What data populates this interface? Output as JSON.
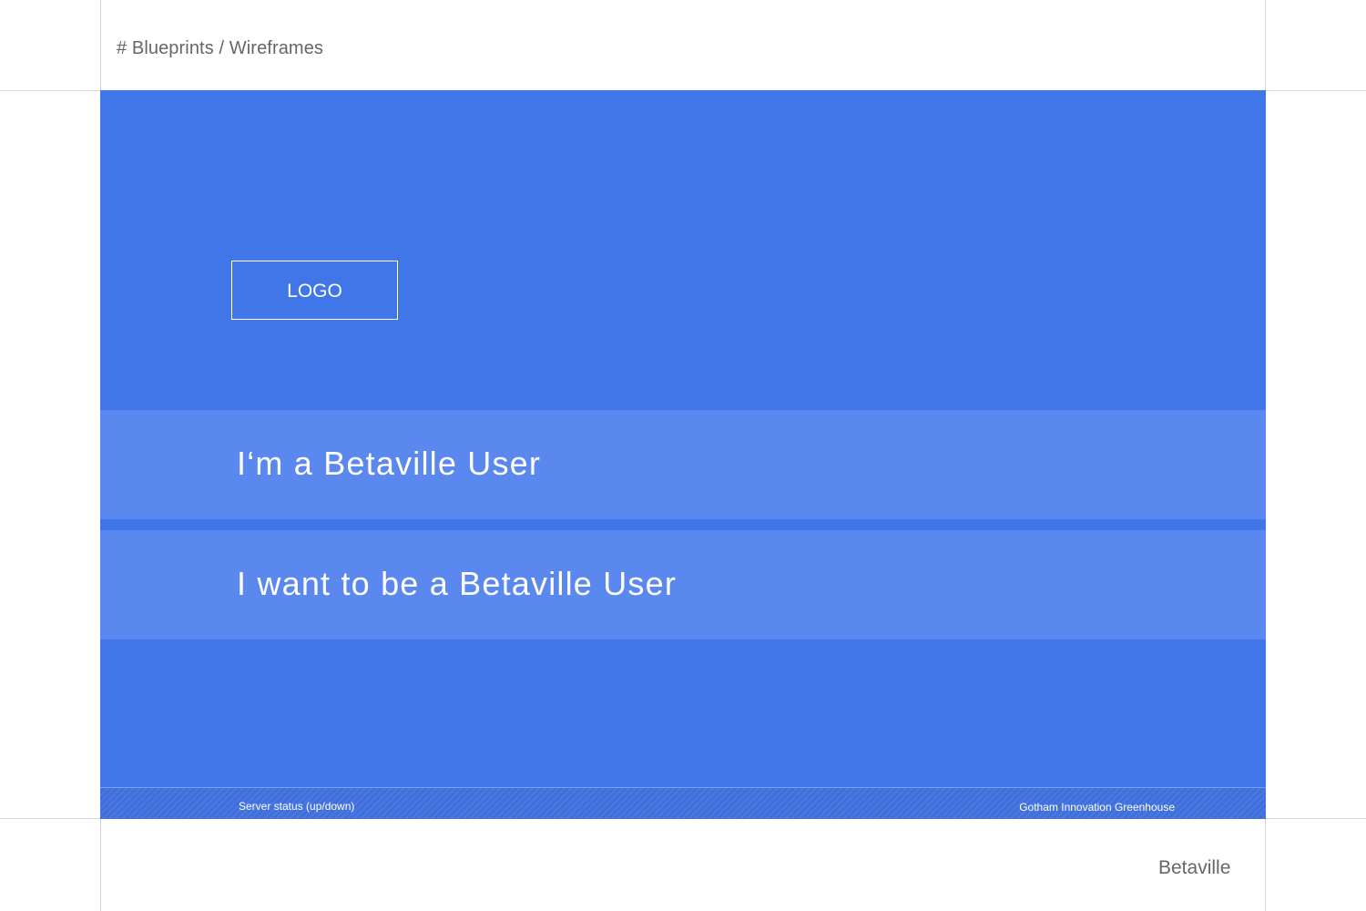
{
  "header": {
    "breadcrumb": "# Blueprints / Wireframes"
  },
  "screen": {
    "logo_placeholder": "LOGO",
    "options": [
      {
        "label": "I‘m a Betaville User"
      },
      {
        "label": "I want to be a Betaville User"
      }
    ],
    "footer": {
      "server_status": "Server status (up/down)",
      "organization": "Gotham Innovation Greenhouse"
    }
  },
  "brand": {
    "name": "Betaville"
  },
  "colors": {
    "screen_background": "#4176e8",
    "option_background": "#5b88ef",
    "guide_lines": "#d9d9d9",
    "text_gray": "#666666"
  }
}
